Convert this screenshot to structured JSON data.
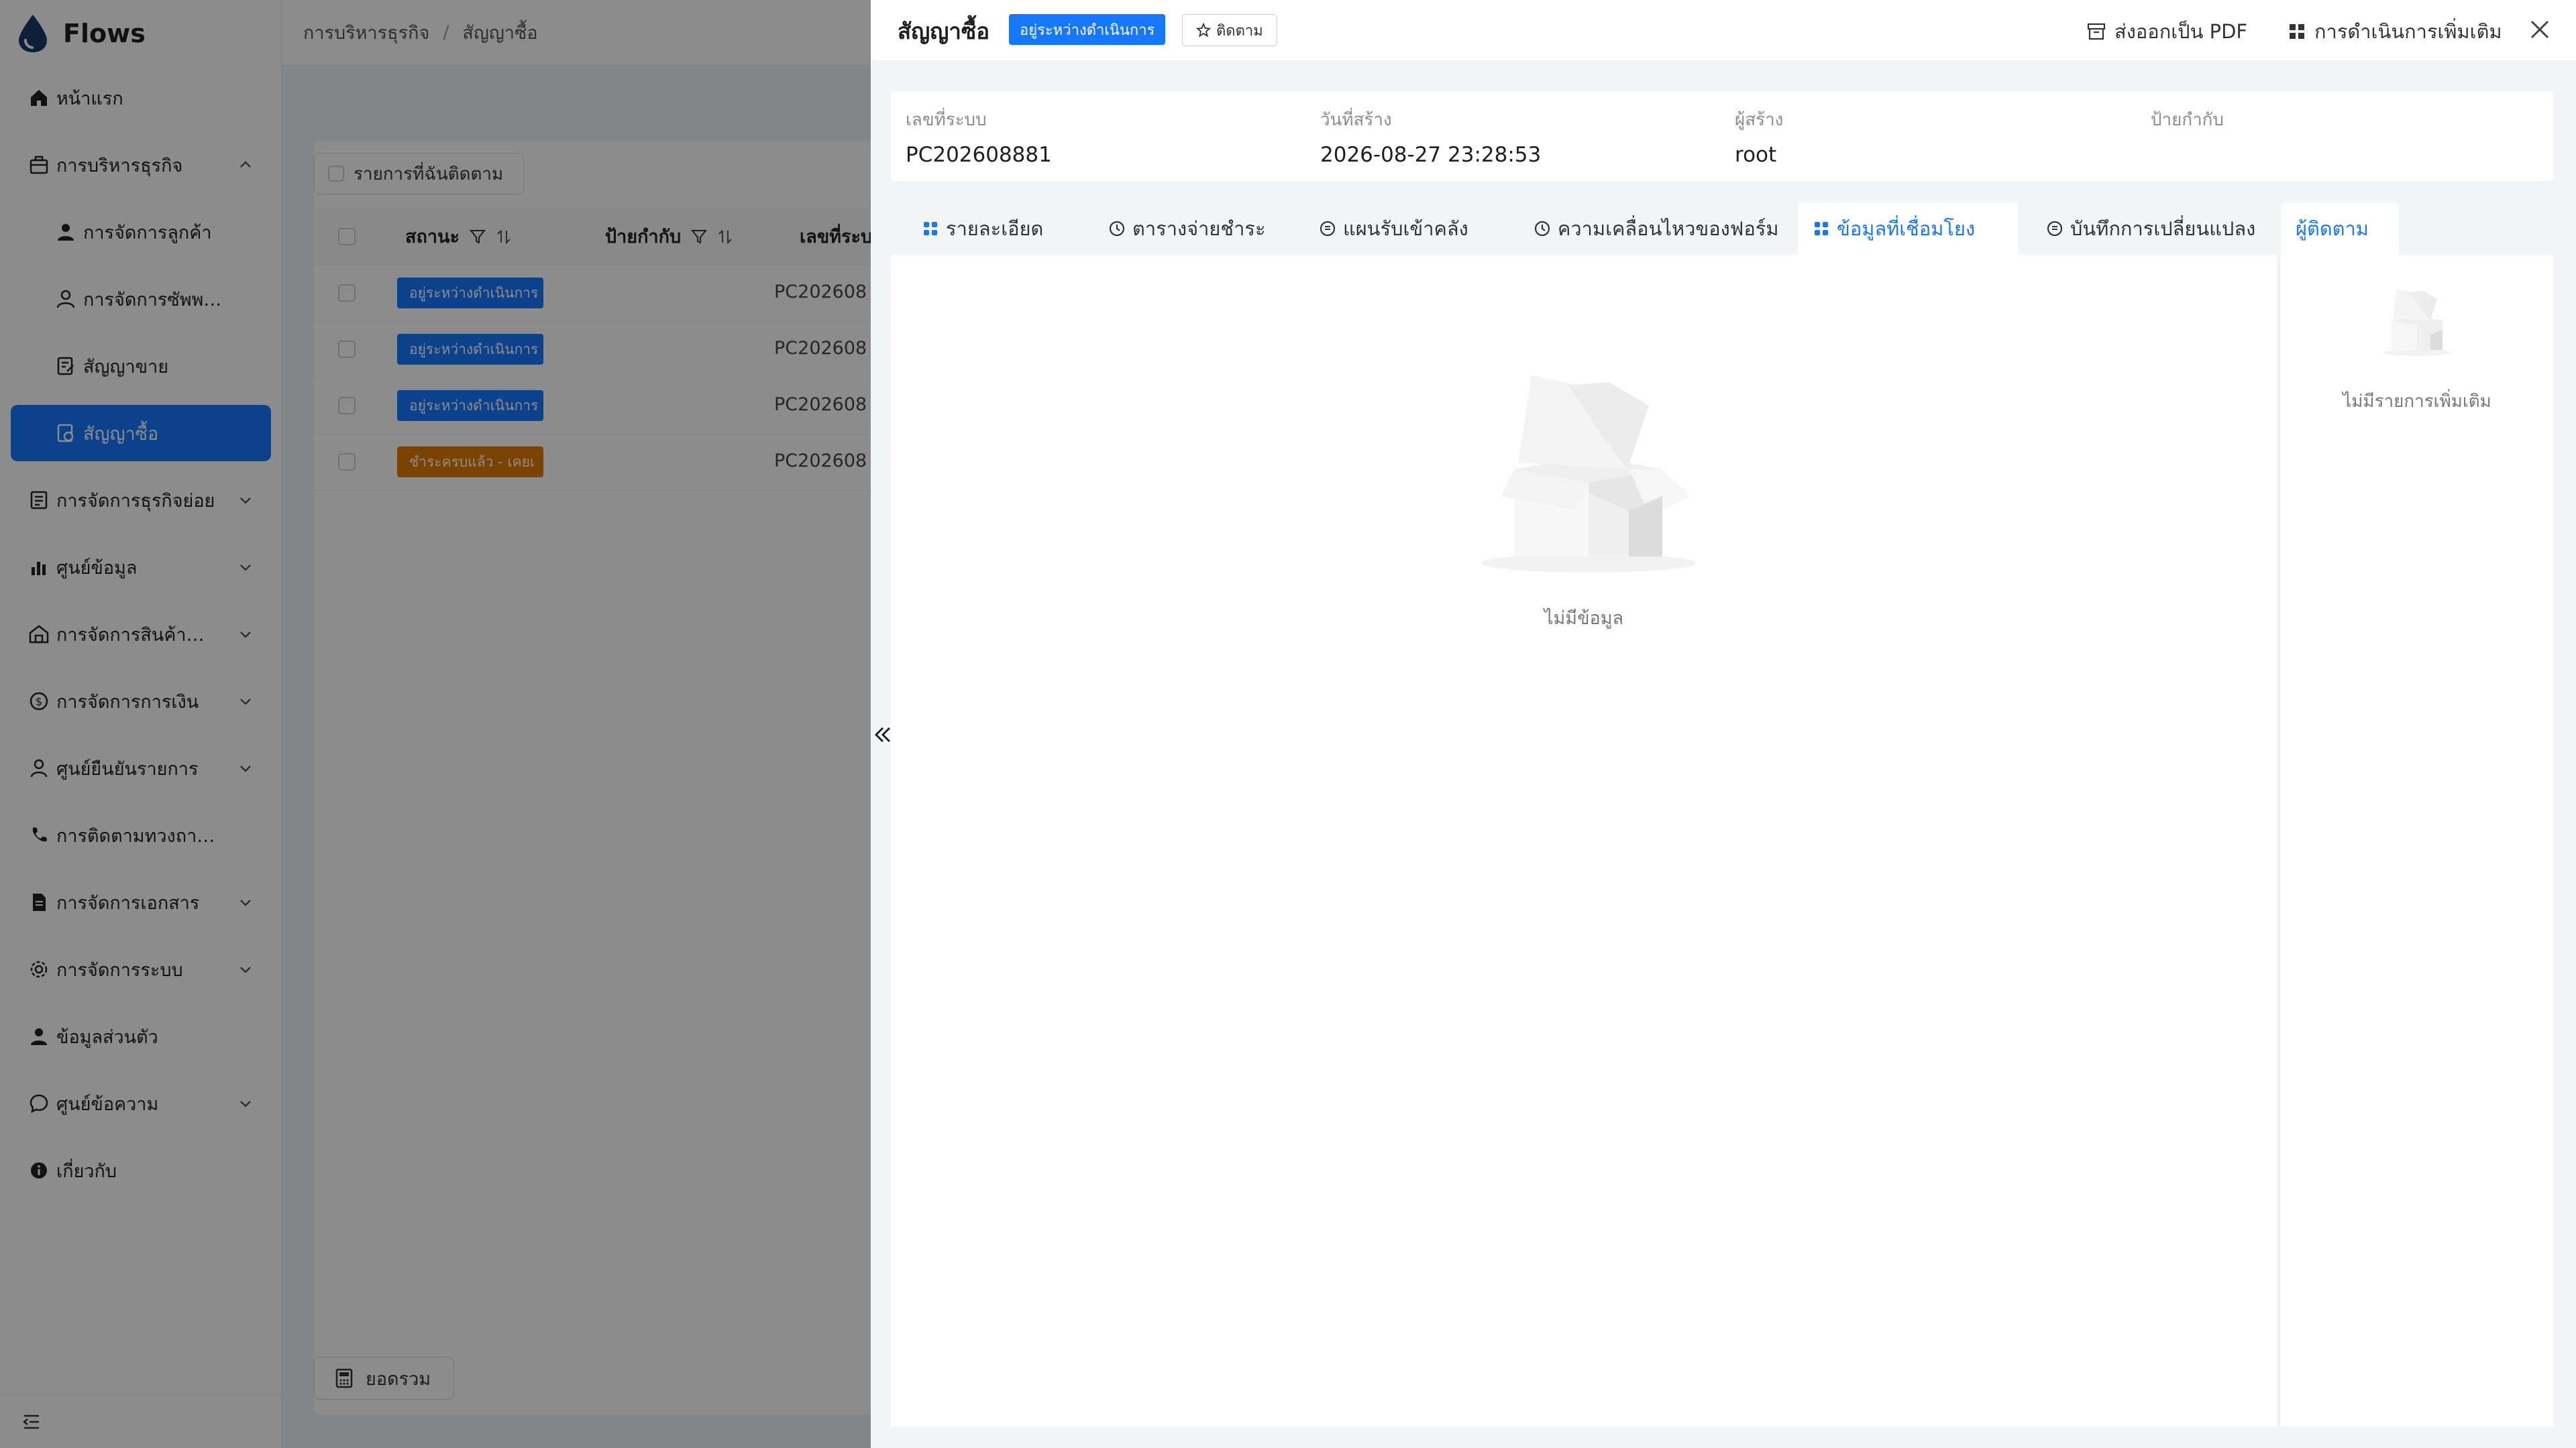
{
  "app": {
    "name": "Flows"
  },
  "sidebar": {
    "items": [
      {
        "label": "หน้าแรก",
        "icon": "home-icon"
      },
      {
        "label": "การบริหารธุรกิจ",
        "icon": "briefcase-icon",
        "expanded": true
      },
      {
        "label": "การจัดการลูกค้า",
        "icon": "user-icon",
        "sub": true
      },
      {
        "label": "การจัดการซัพพลายเออร์",
        "icon": "user-outline-icon",
        "sub": true
      },
      {
        "label": "สัญญาขาย",
        "icon": "contract-icon",
        "sub": true
      },
      {
        "label": "สัญญาซื้อ",
        "icon": "purchase-contract-icon",
        "sub": true,
        "active": true
      },
      {
        "label": "การจัดการธุรกิจย่อย",
        "icon": "document-icon",
        "collapsible": true
      },
      {
        "label": "ศูนย์ข้อมูล",
        "icon": "bar-chart-icon",
        "collapsible": true
      },
      {
        "label": "การจัดการสินค้าคงคลัง",
        "icon": "warehouse-icon",
        "collapsible": true
      },
      {
        "label": "การจัดการการเงิน",
        "icon": "dollar-circle-icon",
        "collapsible": true
      },
      {
        "label": "ศูนย์ยืนยันรายการ",
        "icon": "user-check-icon",
        "collapsible": true
      },
      {
        "label": "การติดตามทวงถามหนี้",
        "icon": "phone-icon"
      },
      {
        "label": "การจัดการเอกสาร",
        "icon": "file-icon",
        "collapsible": true
      },
      {
        "label": "การจัดการระบบ",
        "icon": "gear-icon",
        "collapsible": true
      },
      {
        "label": "ข้อมูลส่วนตัว",
        "icon": "profile-icon"
      },
      {
        "label": "ศูนย์ข้อความ",
        "icon": "message-icon",
        "collapsible": true
      },
      {
        "label": "เกี่ยวกับ",
        "icon": "info-icon"
      }
    ]
  },
  "breadcrumb": {
    "parent": "การบริหารธุรกิจ",
    "current": "สัญญาซื้อ"
  },
  "list": {
    "follow_filter": "รายการที่ฉันติดตาม",
    "columns": {
      "status": "สถานะ",
      "tags": "ป้ายกำกับ",
      "code": "เลขที่ระบบ"
    },
    "rows": [
      {
        "status": "อยู่ระหว่างดำเนินการ",
        "status_color": "#1677ff",
        "code": "PC202608"
      },
      {
        "status": "อยู่ระหว่างดำเนินการ",
        "status_color": "#1677ff",
        "code": "PC202608"
      },
      {
        "status": "อยู่ระหว่างดำเนินการ",
        "status_color": "#1677ff",
        "code": "PC202608"
      },
      {
        "status": "ชำระครบแล้ว - เคยเ",
        "status_color": "#e07b00",
        "code": "PC202608"
      }
    ],
    "summary_button": "ยอดรวม"
  },
  "drawer": {
    "title": "สัญญาซื้อ",
    "status_tag": "อยู่ระหว่างดำเนินการ",
    "follow_button": "ติดตาม",
    "export_pdf": "ส่งออกเป็น PDF",
    "more_actions": "การดำเนินการเพิ่มเติม",
    "info": [
      {
        "label": "เลขที่ระบบ",
        "value": "PC202608881"
      },
      {
        "label": "วันที่สร้าง",
        "value": "2026-08-27 23:28:53"
      },
      {
        "label": "ผู้สร้าง",
        "value": "root"
      },
      {
        "label": "ป้ายกำกับ",
        "value": ""
      }
    ],
    "tabs": [
      {
        "label": "รายละเอียด",
        "icon": "grid-icon"
      },
      {
        "label": "ตารางจ่ายชำระ",
        "icon": "clock-icon"
      },
      {
        "label": "แผนรับเข้าคลัง",
        "icon": "circle-list-icon"
      },
      {
        "label": "ความเคลื่อนไหวของฟอร์ม",
        "icon": "clock-icon"
      },
      {
        "label": "ข้อมูลที่เชื่อมโยง",
        "icon": "grid-icon",
        "active": true
      },
      {
        "label": "บันทึกการเปลี่ยนแปลง",
        "icon": "circle-list-icon"
      }
    ],
    "followers_tab": "ผู้ติดตาม",
    "empty_text": "ไม่มีข้อมูล",
    "followers_empty_text": "ไม่มีรายการเพิ่มเติม"
  },
  "colors": {
    "primary": "#1677ff",
    "warning": "#e07b00",
    "overlay": "rgba(0,0,0,0.45)"
  }
}
